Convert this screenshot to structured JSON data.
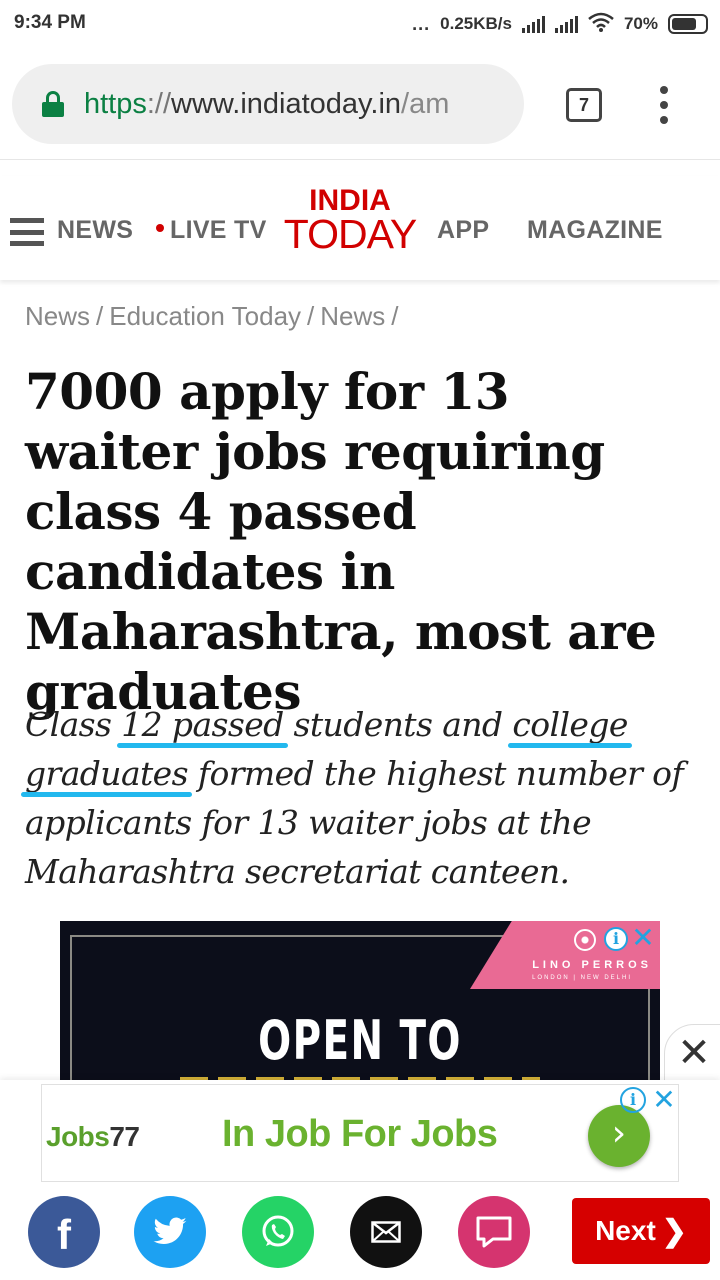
{
  "status_bar": {
    "time": "9:34 PM",
    "dots": "...",
    "network_speed": "0.25KB/s",
    "battery": "70%"
  },
  "browser": {
    "url_scheme": "https",
    "url_sep": "://",
    "url_host": "www.indiatoday.in",
    "url_path": "/am",
    "tab_count": "7"
  },
  "site_nav": {
    "news": "NEWS",
    "live_tv": "LIVE TV",
    "logo_top": "INDIA",
    "logo_bottom": "TODAY",
    "app": "APP",
    "magazine": "MAGAZINE"
  },
  "breadcrumb": {
    "items": [
      "News",
      "Education Today",
      "News"
    ],
    "separator": "/"
  },
  "article": {
    "headline": "7000 apply for 13 waiter jobs requiring class 4 passed candidates in Maharashtra, most are graduates",
    "summary": {
      "p1": "Class ",
      "h1": "12 passed",
      "p2": " students and ",
      "h2": "college",
      "p3": " ",
      "h3": "graduates",
      "p4": " formed the highest number of applicants for 13 waiter jobs at the Maharashtra secretariat canteen."
    },
    "highlight_color": "#22b8ee"
  },
  "ad": {
    "brand": "LINO PERROS",
    "brand_sub": "LONDON | NEW DELHI",
    "headline": "OPEN TO",
    "info_label": "i",
    "close_label": "✕"
  },
  "overlay_close": "✕",
  "banner": {
    "logo_text": "Jobs",
    "logo_num": "77",
    "title": "In Job For Jobs",
    "go": "›",
    "info_label": "i",
    "close_label": "✕"
  },
  "share": {
    "facebook": "f",
    "next_label": "Next",
    "next_chevron": "❯"
  },
  "colors": {
    "brand_red": "#d10000",
    "facebook": "#3b5998",
    "twitter": "#1da1f2",
    "whatsapp": "#25d366",
    "comment": "#d5346f",
    "banner_green": "#6ab22f"
  }
}
